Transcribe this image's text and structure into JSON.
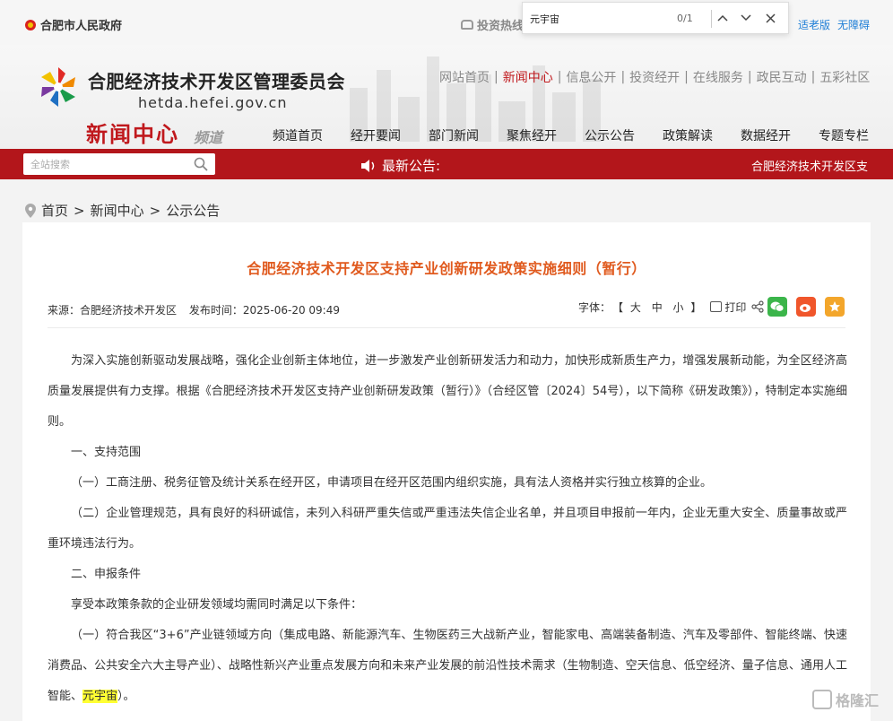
{
  "topbar": {
    "gov_link": "合肥市人民政府",
    "invest_hotline": "投资热线",
    "accessibility": [
      "适老版",
      "无障碍"
    ]
  },
  "findbar": {
    "query": "元宇宙",
    "count": "0/1",
    "prev_icon": "chevron-up",
    "next_icon": "chevron-down",
    "close_icon": "close"
  },
  "header": {
    "org_name": "合肥经济技术开发区管理委员会",
    "domain": "hetda.hefei.gov.cn",
    "channel_title": "新闻中心",
    "channel_sub": "频道",
    "top_links": [
      "网站首页",
      "新闻中心",
      "信息公开",
      "投资经开",
      "在线服务",
      "政民互动",
      "五彩社区"
    ],
    "active_top_link": 1,
    "nav": [
      "频道首页",
      "经开要闻",
      "部门新闻",
      "聚焦经开",
      "公示公告",
      "政策解读",
      "数据经开",
      "专题专栏"
    ]
  },
  "redbar": {
    "search_placeholder": "全站搜索",
    "notice_label": "最新公告:",
    "marquee": "合肥经济技术开发区支"
  },
  "breadcrumb": [
    "首页",
    "新闻中心",
    "公示公告"
  ],
  "breadcrumb_sep": ">",
  "article": {
    "title": "合肥经济技术开发区支持产业创新研发政策实施细则（暂行）",
    "source": "来源：合肥经济技术开发区",
    "published": "发布时间：2025-06-20 09:49",
    "font_label": "字体：",
    "bracket_open": "【",
    "bracket_close": "】",
    "sizes": [
      "大",
      "中",
      "小"
    ],
    "print_label": "打印",
    "paragraphs": [
      "为深入实施创新驱动发展战略，强化企业创新主体地位，进一步激发产业创新研发活力和动力，加快形成新质生产力，增强发展新动能，为全区经济高质量发展提供有力支撑。根据《合肥经济技术开发区支持产业创新研发政策（暂行）》（合经区管〔2024〕54号），以下简称《研发政策》），特制定本实施细则。",
      "一、支持范围",
      "（一）工商注册、税务征管及统计关系在经开区，申请项目在经开区范围内组织实施，具有法人资格并实行独立核算的企业。",
      "（二）企业管理规范，具有良好的科研诚信，未列入科研严重失信或严重违法失信企业名单，并且项目申报前一年内，企业无重大安全、质量事故或严重环境违法行为。",
      "二、申报条件",
      "享受本政策条款的企业研发领域均需同时满足以下条件："
    ],
    "last_paragraph_before": "（一）符合我区“3+6”产业链领域方向（集成电路、新能源汽车、生物医药三大战新产业，智能家电、高端装备制造、汽车及零部件、智能终端、快速消费品、公共安全六大主导产业）、战略性新兴产业重点发展方向和未来产业发展的前沿性技术需求（生物制造、空天信息、低空经济、量子信息、通用人工智能、",
    "last_paragraph_highlight": "元宇宙",
    "last_paragraph_after": "）。"
  },
  "watermark": "格隆汇",
  "colors": {
    "brand_red": "#b3161b",
    "title_orange": "#e05a1e",
    "link_blue": "#1e7ed6",
    "highlight": "#ffff33"
  }
}
